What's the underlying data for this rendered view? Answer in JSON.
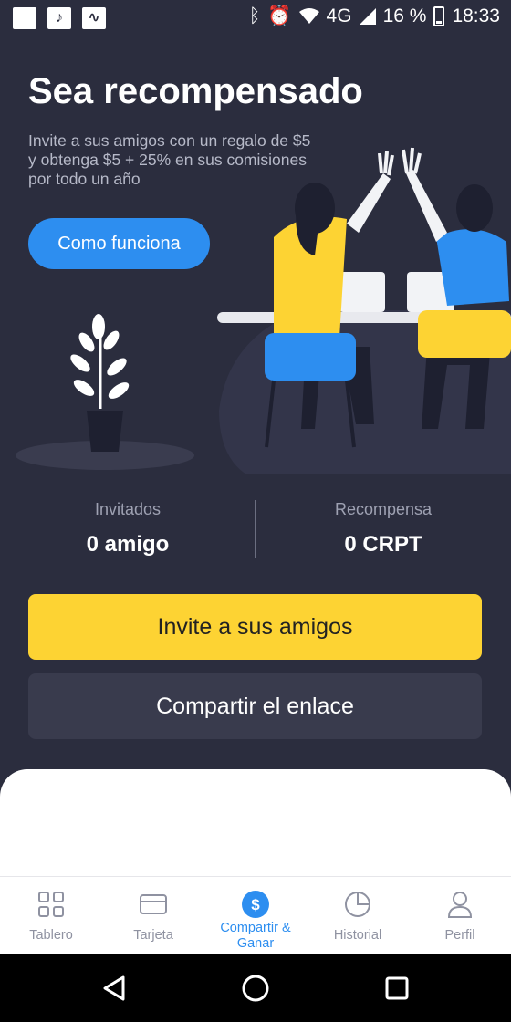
{
  "status_bar": {
    "signal_text": "4G",
    "battery": "16 %",
    "time": "18:33",
    "icons": [
      "notification-square-icon",
      "music-note-icon",
      "activity-icon",
      "bluetooth-icon",
      "alarm-icon",
      "wifi-icon",
      "signal-icon",
      "battery-icon"
    ]
  },
  "hero": {
    "title": "Sea recompensado",
    "subtitle": "Invite a sus amigos con un regalo de $5 y obtenga $5 + 25% en sus comisiones por todo un año",
    "how_button": "Como funciona"
  },
  "stats": {
    "invited_label": "Invitados",
    "invited_value": "0 amigo",
    "reward_label": "Recompensa",
    "reward_value": "0 CRPT"
  },
  "actions": {
    "invite": "Invite a sus amigos",
    "share": "Compartir el enlace"
  },
  "tabs": [
    {
      "label": "Tablero",
      "icon": "grid-icon"
    },
    {
      "label": "Tarjeta",
      "icon": "card-icon"
    },
    {
      "label": "Compartir & Ganar",
      "icon": "dollar-icon"
    },
    {
      "label": "Historial",
      "icon": "pie-chart-icon"
    },
    {
      "label": "Perfil",
      "icon": "user-icon"
    }
  ],
  "colors": {
    "background": "#2b2d3e",
    "accent_blue": "#2d8ef0",
    "accent_yellow": "#fdd333"
  }
}
